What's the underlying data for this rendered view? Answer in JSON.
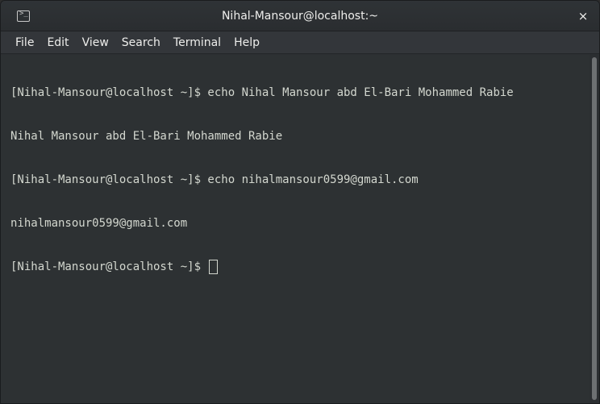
{
  "window": {
    "title": "Nihal-Mansour@localhost:~",
    "close_glyph": "×",
    "app_icon": "terminal-icon"
  },
  "menubar": {
    "items": [
      "File",
      "Edit",
      "View",
      "Search",
      "Terminal",
      "Help"
    ]
  },
  "terminal": {
    "lines": [
      "[Nihal-Mansour@localhost ~]$ echo Nihal Mansour abd El-Bari Mohammed Rabie",
      "Nihal Mansour abd El-Bari Mohammed Rabie",
      "[Nihal-Mansour@localhost ~]$ echo nihalmansour0599@gmail.com",
      "nihalmansour0599@gmail.com"
    ],
    "prompt": "[Nihal-Mansour@localhost ~]$ "
  },
  "colors": {
    "background": "#2d3133",
    "foreground": "#d3d7cf",
    "titlebar": "#2f3336",
    "menubar": "#33363a"
  }
}
